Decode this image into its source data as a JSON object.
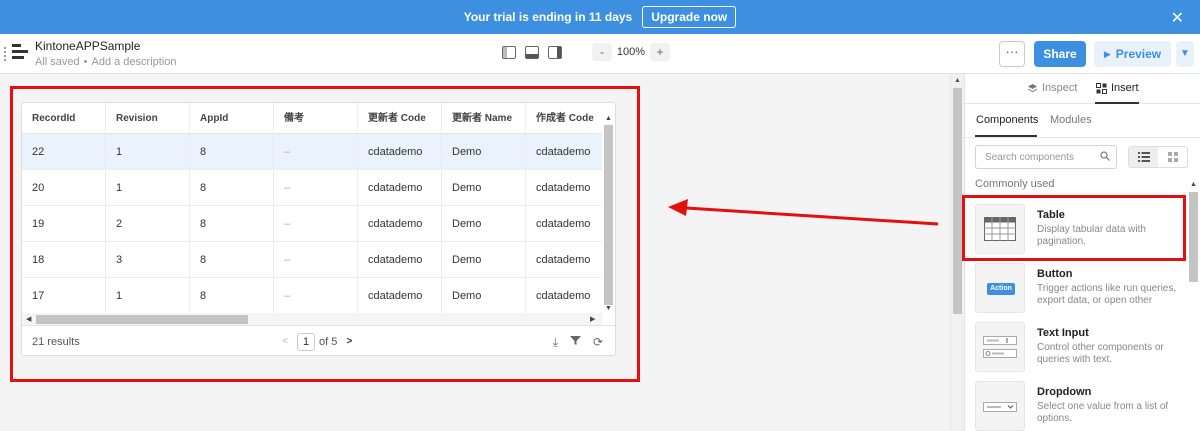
{
  "banner": {
    "text": "Your trial is ending in 11 days",
    "upgrade_label": "Upgrade now",
    "close_icon": "close-icon"
  },
  "header": {
    "app_name": "KintoneAPPSample",
    "saved_status": "All saved",
    "separator": "•",
    "description_placeholder": "Add a description",
    "zoom_minus": "-",
    "zoom_value": "100%",
    "zoom_plus": "+",
    "more_label": "···",
    "share_label": "Share",
    "preview_label": "Preview"
  },
  "table": {
    "columns": [
      "RecordId",
      "Revision",
      "AppId",
      "備考",
      "更新者 Code",
      "更新者 Name",
      "作成者 Code"
    ],
    "rows": [
      [
        "22",
        "1",
        "8",
        "–",
        "cdatademo",
        "Demo",
        "cdatademo"
      ],
      [
        "20",
        "1",
        "8",
        "–",
        "cdatademo",
        "Demo",
        "cdatademo"
      ],
      [
        "19",
        "2",
        "8",
        "–",
        "cdatademo",
        "Demo",
        "cdatademo"
      ],
      [
        "18",
        "3",
        "8",
        "–",
        "cdatademo",
        "Demo",
        "cdatademo"
      ],
      [
        "17",
        "1",
        "8",
        "–",
        "cdatademo",
        "Demo",
        "cdatademo"
      ]
    ],
    "selected_row": 0,
    "results_label": "21 results",
    "page_current": "1",
    "page_total": "of 5"
  },
  "panel": {
    "tabs": [
      {
        "label": "Inspect",
        "icon": "layers-icon"
      },
      {
        "label": "Insert",
        "icon": "insert-icon"
      }
    ],
    "sub_tabs": [
      "Components",
      "Modules"
    ],
    "search_placeholder": "Search components",
    "section_label": "Commonly used",
    "components": [
      {
        "name": "Table",
        "description": "Display tabular data with pagination."
      },
      {
        "name": "Button",
        "description": "Trigger actions like run queries, export data, or open other",
        "badge": "Action"
      },
      {
        "name": "Text Input",
        "description": "Control other components or queries with text."
      },
      {
        "name": "Dropdown",
        "description": "Select one value from a list of options."
      }
    ]
  },
  "colors": {
    "primary": "#3d8fe0",
    "highlight": "#e41010"
  }
}
